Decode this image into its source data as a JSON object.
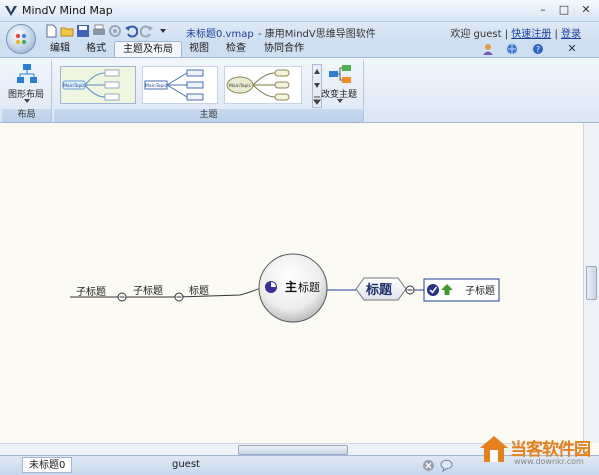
{
  "window": {
    "title": "MindV Mind Map",
    "min_icon": "minimize-icon",
    "max_icon": "maximize-icon",
    "close_icon": "close-icon"
  },
  "quick_access": {
    "icons": [
      "new-file-icon",
      "open-folder-icon",
      "save-icon",
      "print-icon",
      "settings-icon",
      "undo-icon",
      "redo-icon",
      "customize-dropdown-icon"
    ],
    "doc_title": "未标题0.vmap",
    "doc_subtitle": " - 康用MindV思维导图软件",
    "welcome": "欢迎 guest",
    "sep": "|",
    "register": "快速注册",
    "login": "登录"
  },
  "tabs": [
    {
      "label": "编辑",
      "active": false
    },
    {
      "label": "格式",
      "active": false
    },
    {
      "label": "主题及布局",
      "active": true
    },
    {
      "label": "视图",
      "active": false
    },
    {
      "label": "检查",
      "active": false
    },
    {
      "label": "协同合作",
      "active": false
    }
  ],
  "ribbon": {
    "layout_group": {
      "label": "布局",
      "button_label": "图形布局"
    },
    "theme_group": {
      "label": "主题",
      "change_label": "改变主题",
      "thumbnails": [
        {
          "main": "MainTopic",
          "sub": "Topic"
        },
        {
          "main": "MainTopic",
          "sub": "Topic"
        },
        {
          "main": "MainTopic",
          "sub": "Topic"
        }
      ]
    }
  },
  "map": {
    "central": {
      "bold": "主",
      "rest": "标题"
    },
    "topic": "标题",
    "right_subtopic": "子标题",
    "left_nodes": [
      "标题",
      "子标题",
      "子标题"
    ]
  },
  "statusbar": {
    "sheet_tab": "未标题0",
    "user": "guest"
  },
  "watermark": {
    "text": "当客软件园",
    "url": "www.downkr.com"
  },
  "colors": {
    "accent": "#1d3f9b",
    "ribbon_bg": "#dce7f5",
    "canvas_bg": "#fbfaf3",
    "watermark": "#e6801a"
  }
}
